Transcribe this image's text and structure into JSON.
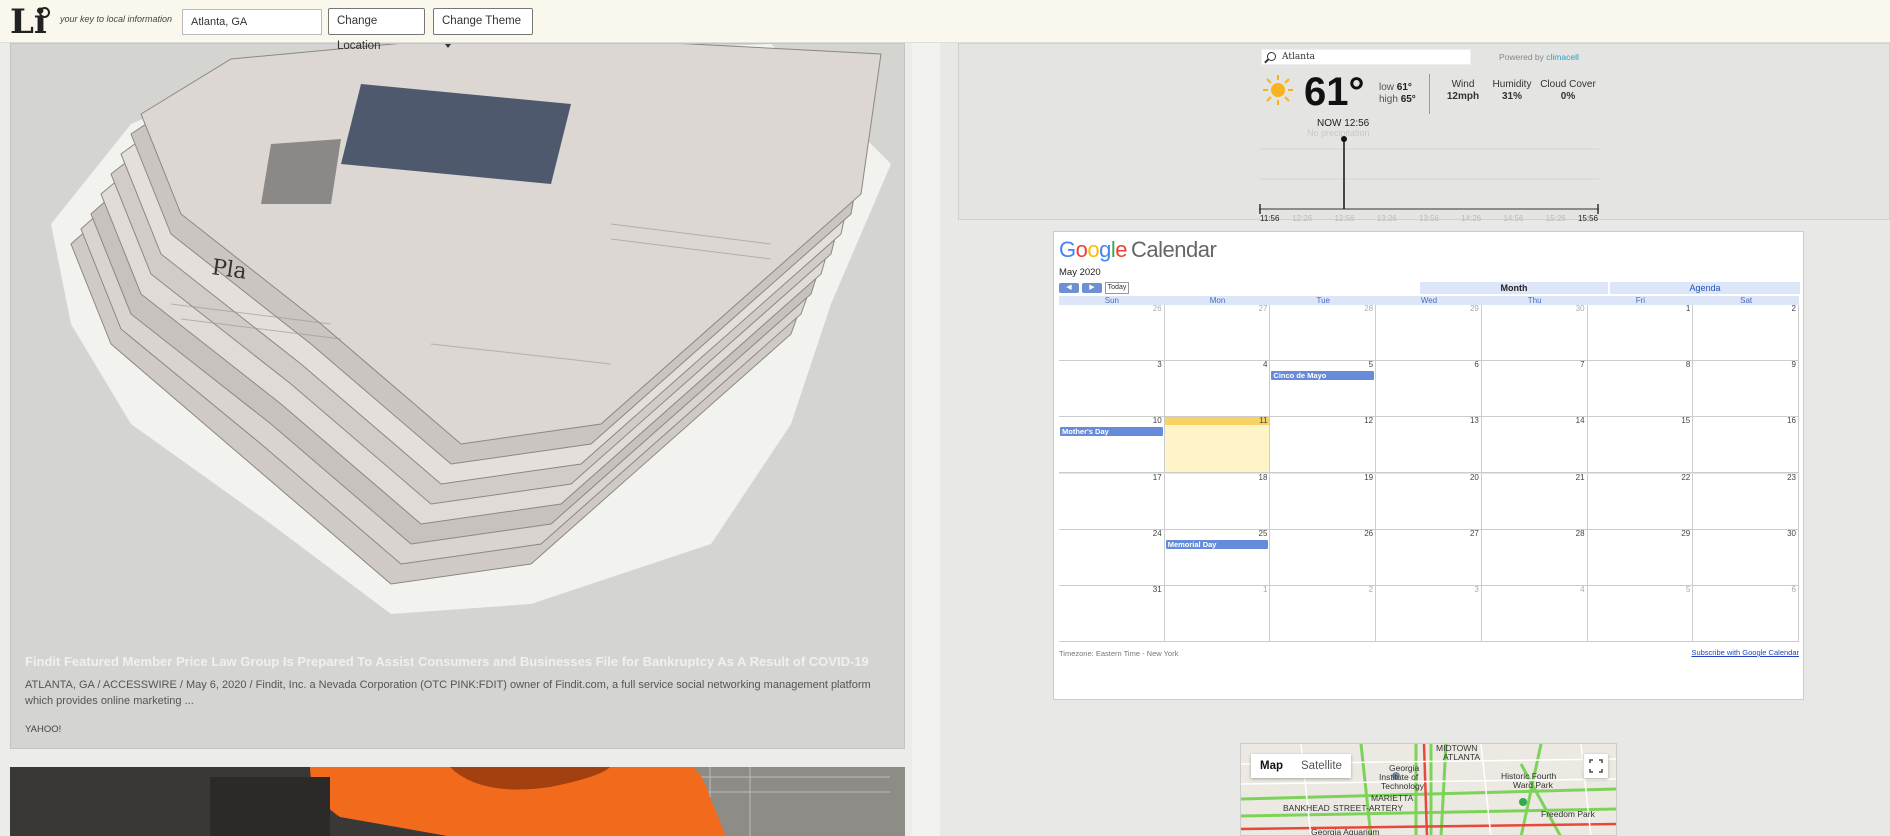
{
  "topbar": {
    "logo": "Li",
    "tagline": "your key to local information",
    "location_value": "Atlanta, GA",
    "change_location": "Change Location",
    "change_theme": "Change Theme"
  },
  "articles": [
    {
      "title": "Findit Featured Member Price Law Group Is Prepared To Assist Consumers and Businesses File for Bankruptcy As A Result of COVID-19",
      "description": "ATLANTA, GA / ACCESSWIRE / May 6, 2020 / Findit, Inc. a Nevada Corporation (OTC PINK:FDIT) owner of Findit.com, a full service social networking management platform which provides online marketing ...",
      "source": "YAHOO!"
    }
  ],
  "weather": {
    "search_value": "Atlanta",
    "powered_by": "Powered by",
    "provider": "climacell",
    "icon": "sun-icon",
    "temp": "61°",
    "low_label": "low",
    "low": "61°",
    "high_label": "high",
    "high": "65°",
    "wind_label": "Wind",
    "wind": "12mph",
    "humidity_label": "Humidity",
    "humidity": "31%",
    "cloud_label": "Cloud Cover",
    "cloud": "0%",
    "now": "NOW 12:56",
    "no_precip": "No precipitation",
    "times": [
      "11:56",
      "12:26",
      "12:56",
      "13:26",
      "13:56",
      "14:26",
      "14:56",
      "15:26",
      "15:56"
    ]
  },
  "calendar": {
    "logo_google": "Google",
    "logo_calendar": "Calendar",
    "month": "May 2020",
    "today_btn": "Today",
    "tab_month": "Month",
    "tab_agenda": "Agenda",
    "days": [
      "Sun",
      "Mon",
      "Tue",
      "Wed",
      "Thu",
      "Fri",
      "Sat"
    ],
    "weeks": [
      [
        "26",
        "27",
        "28",
        "29",
        "30",
        "1",
        "2"
      ],
      [
        "3",
        "4",
        "5",
        "6",
        "7",
        "8",
        "9"
      ],
      [
        "10",
        "11",
        "12",
        "13",
        "14",
        "15",
        "16"
      ],
      [
        "17",
        "18",
        "19",
        "20",
        "21",
        "22",
        "23"
      ],
      [
        "24",
        "25",
        "26",
        "27",
        "28",
        "29",
        "30"
      ],
      [
        "31",
        "1",
        "2",
        "3",
        "4",
        "5",
        "6"
      ]
    ],
    "events": {
      "cinco": "Cinco de Mayo",
      "mothers": "Mother's Day",
      "memorial": "Memorial Day"
    },
    "timezone": "Timezone: Eastern Time - New York",
    "subscribe": "Subscribe with Google Calendar"
  },
  "map": {
    "tab_map": "Map",
    "tab_satellite": "Satellite",
    "labels": [
      "MIDTOWN",
      "ATLANTA",
      "Georgia",
      "Institute of",
      "Technology",
      "MARIETTA",
      "BANKHEAD",
      "STREET-ARTERY",
      "Historic Fourth",
      "Ward Park",
      "Freedom Park",
      "Georgia Aquarium"
    ]
  }
}
